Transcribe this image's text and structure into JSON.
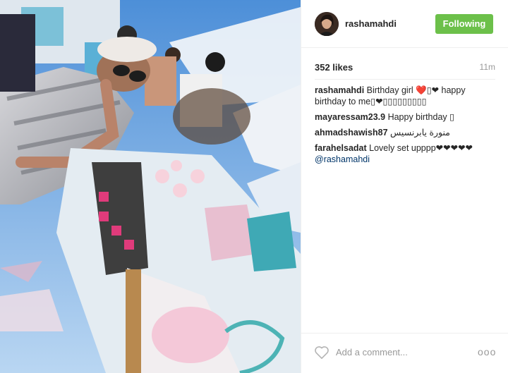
{
  "header": {
    "username": "rashamahdi",
    "follow_label": "Following"
  },
  "post": {
    "likes": "352 likes",
    "time": "11m"
  },
  "comments": [
    {
      "user": "rashamahdi",
      "text": "Birthday girl ❤️▯❤ happy birthday to me▯❤▯▯▯▯▯▯▯▯▯",
      "mention": ""
    },
    {
      "user": "mayaressam23.9",
      "text": "Happy birthday ▯",
      "mention": ""
    },
    {
      "user": "ahmadshawish87",
      "text": "منورة يابرنسيس",
      "mention": ""
    },
    {
      "user": "farahelsadat",
      "text": "Lovely set upppp❤❤❤❤❤",
      "mention": "@rashamahdi"
    }
  ],
  "footer": {
    "add_comment_placeholder": "Add a comment...",
    "more_label": "ooo"
  },
  "icons": {
    "like": "heart-icon",
    "more": "more-options-icon"
  },
  "colors": {
    "follow_button": "#6cc04a",
    "mention": "#003569",
    "meta_grey": "#999999"
  }
}
